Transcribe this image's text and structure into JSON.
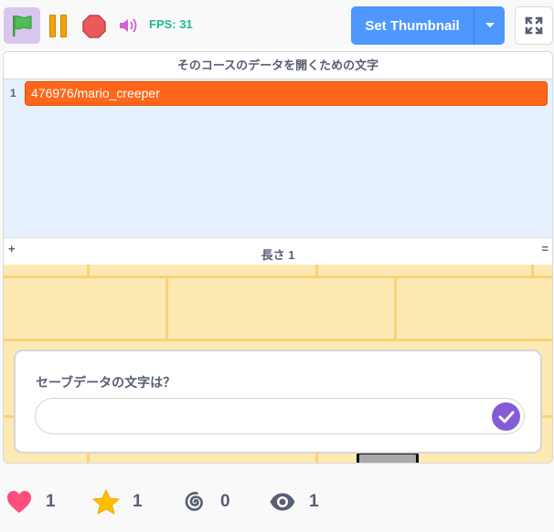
{
  "toolbar": {
    "fps_label": "FPS: 31",
    "thumbnail_label": "Set Thumbnail"
  },
  "list_monitor": {
    "title": "そのコースのデータを開くための文字",
    "items": [
      {
        "index": "1",
        "value": "476976/mario_creeper"
      }
    ],
    "add_label": "+",
    "length_label": "長さ 1",
    "resize_label": "="
  },
  "ask_prompt": {
    "question": "セーブデータの文字は？",
    "value": ""
  },
  "stats": {
    "loves": "1",
    "favorites": "1",
    "remixes": "0",
    "views": "1"
  },
  "colors": {
    "accent": "#4d97ff",
    "list_item": "#ff661a",
    "submit": "#855cd6",
    "heart": "#ff4d7d",
    "star": "#ffbf00"
  }
}
